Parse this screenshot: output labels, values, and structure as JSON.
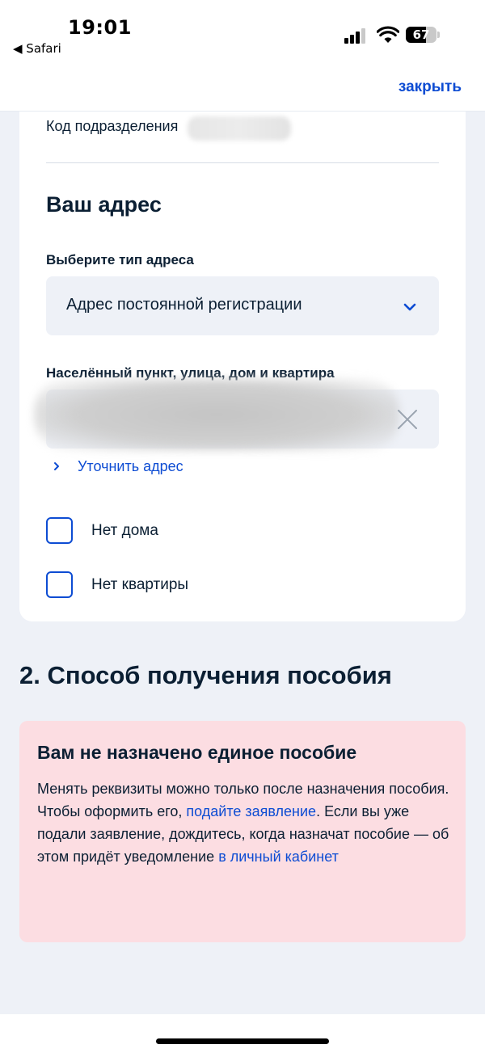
{
  "status_bar": {
    "time": "19:01",
    "back_app": "◀ Safari",
    "battery_percent": "67",
    "battery_level": 0.67
  },
  "top_bar": {
    "close_label": "закрыть"
  },
  "form": {
    "department_code_label": "Код подразделения",
    "address_heading": "Ваш адрес",
    "address_type_label": "Выберите тип адреса",
    "address_type_value": "Адрес постоянной регистрации",
    "locality_label": "Населённый пункт, улица, дом и квартира",
    "refine_address_link": "Уточнить адрес",
    "checkboxes": [
      {
        "label": "Нет дома",
        "checked": false
      },
      {
        "label": "Нет квартиры",
        "checked": false
      }
    ]
  },
  "section2": {
    "title": "2. Способ получения пособия",
    "alert": {
      "title": "Вам не назначено единое пособие",
      "line1": "Менять реквизиты можно только после назначения пособия.",
      "line2_pre": "Чтобы оформить его, ",
      "line2_link": "подайте заявление",
      "line2_post": ". Если вы уже подали заявление, дождитесь, когда назначат пособие — об этом придёт уведомление ",
      "line2_link2": "в личный кабинет"
    }
  },
  "colors": {
    "accent": "#0d4cd3",
    "text": "#0b1f33",
    "alert_bg": "#fcdde2",
    "page_bg": "#eef1f7"
  },
  "icons": {
    "select": "chevron-down-icon",
    "clear": "close-icon",
    "refine": "chevron-right-icon"
  }
}
